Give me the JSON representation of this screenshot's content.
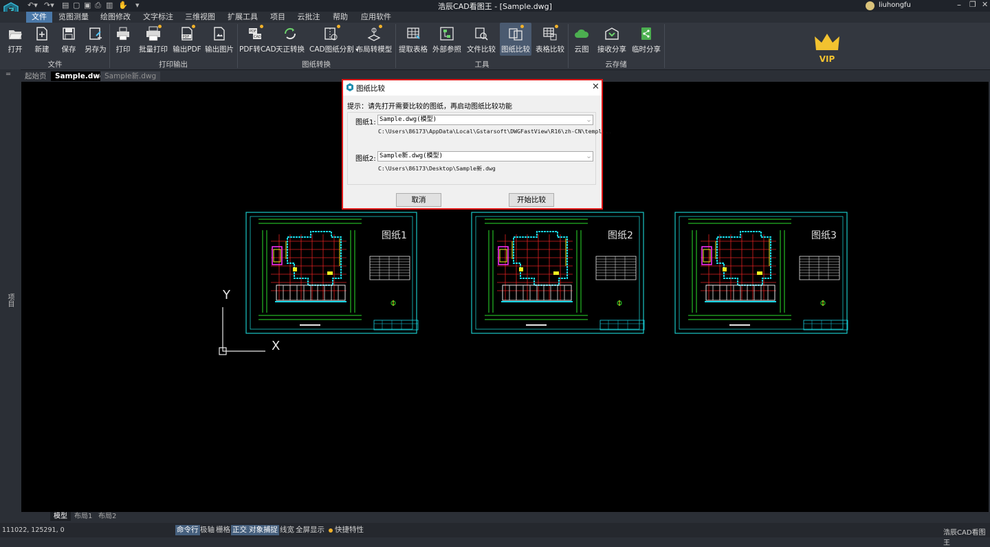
{
  "window": {
    "title": "浩辰CAD看图王 - [Sample.dwg]",
    "user": "liuhongfu"
  },
  "menu": [
    "文件",
    "览图测量",
    "绘图修改",
    "文字标注",
    "三维视图",
    "扩展工具",
    "项目",
    "云批注",
    "帮助",
    "应用软件"
  ],
  "ribbon": {
    "tools": {
      "open": "打开",
      "new": "新建",
      "save": "保存",
      "saveas": "另存为",
      "print": "打印",
      "batch_print": "批量打印",
      "export_pdf": "输出PDF",
      "export_img": "输出图片",
      "pdf2cad": "PDF转CAD",
      "tianzheng": "天正转换",
      "split": "CAD图纸分割",
      "layout2model": "布局转模型",
      "extract_table": "提取表格",
      "xref": "外部参照",
      "file_compare": "文件比较",
      "drawing_compare": "图纸比较",
      "table_compare": "表格比较",
      "cloud": "云图",
      "receive_share": "接收分享",
      "temp_share": "临时分享"
    },
    "groups": {
      "file": "文件",
      "print": "打印输出",
      "convert": "图纸转换",
      "tools": "工具",
      "cloud": "云存储"
    },
    "vip": "VIP"
  },
  "tabs": {
    "start": "起始页",
    "active": "Sample.dwg",
    "other": "Sample新.dwg"
  },
  "left_panel_label": "项目",
  "canvas": {
    "axis_y": "Y",
    "axis_x": "X",
    "sheets": [
      {
        "label": "图纸1"
      },
      {
        "label": "图纸2"
      },
      {
        "label": "图纸3"
      }
    ]
  },
  "dialog": {
    "title": "图纸比较",
    "hint": "提示：请先打开需要比较的图纸，再启动图纸比较功能",
    "drawing1_label": "图纸1:",
    "drawing1_value": "Sample.dwg(模型)",
    "drawing1_path": "C:\\Users\\86173\\AppData\\Local\\Gstarsoft\\DWGFastView\\R16\\zh-CN\\templ...",
    "drawing2_label": "图纸2:",
    "drawing2_value": "Sample新.dwg(模型)",
    "drawing2_path": "C:\\Users\\86173\\Desktop\\Sample新.dwg",
    "cancel": "取消",
    "start": "开始比较"
  },
  "layout_tabs": [
    "模型",
    "布局1",
    "布局2"
  ],
  "status": {
    "coords": "111022, 125291, 0",
    "items": [
      "命令行",
      "极轴",
      "栅格",
      "正交",
      "对象捕捉",
      "线宽",
      "全屏显示",
      "快捷特性"
    ],
    "brand": "浩辰CAD看图王"
  }
}
